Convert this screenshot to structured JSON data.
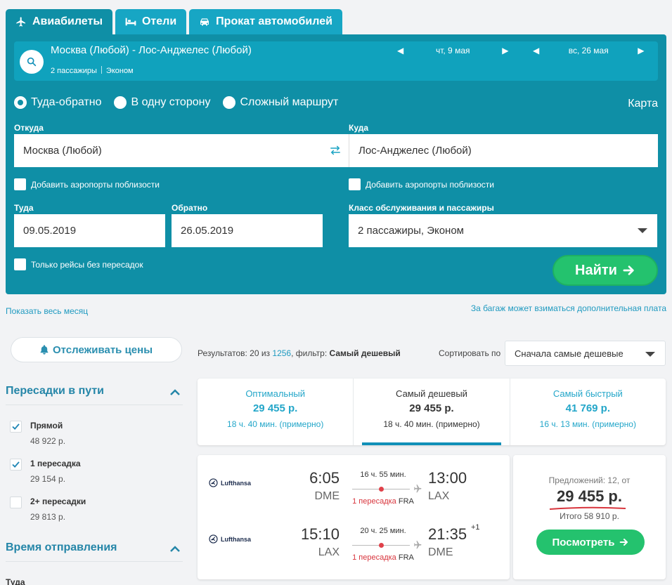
{
  "tabs": [
    {
      "label": "Авиабилеты",
      "icon": "airplane-icon"
    },
    {
      "label": "Отели",
      "icon": "bed-icon"
    },
    {
      "label": "Прокат автомобилей",
      "icon": "car-icon"
    }
  ],
  "summary": {
    "route": "Москва (Любой) - Лос-Анджелес (Любой)",
    "passengers": "2 пассажиры",
    "class": "Эконом",
    "date1": "чт, 9 мая",
    "date2": "вс, 26 мая"
  },
  "trip_types": [
    "Туда-обратно",
    "В одну сторону",
    "Сложный маршрут"
  ],
  "map_label": "Карта",
  "from": {
    "label": "Откуда",
    "value": "Москва (Любой)"
  },
  "to": {
    "label": "Куда",
    "value": "Лос-Анджелес (Любой)"
  },
  "nearby_label": "Добавить аэропорты поблизости",
  "depart": {
    "label": "Туда",
    "value": "09.05.2019"
  },
  "return": {
    "label": "Обратно",
    "value": "26.05.2019"
  },
  "cabin": {
    "label": "Класс обслуживания и пассажиры",
    "value": "2 пассажиры, Эконом"
  },
  "direct_only_label": "Только рейсы без пересадок",
  "find_label": "Найти",
  "show_month": "Показать весь месяц",
  "baggage_note": "За багаж может взиматься дополнительная плата",
  "track_label": "Отслеживать цены",
  "results": {
    "prefix": "Результатов: 20 из",
    "total": "1256",
    "filter_prefix": ", фильтр:",
    "filter_value": "Самый дешевый"
  },
  "sort": {
    "label": "Сортировать по",
    "value": "Сначала самые дешевые"
  },
  "stops_section": {
    "title": "Пересадки в пути",
    "options": [
      {
        "name": "Прямой",
        "price": "48 922 р.",
        "checked": true
      },
      {
        "name": "1 пересадка",
        "price": "29 154 р.",
        "checked": true
      },
      {
        "name": "2+ пересадки",
        "price": "29 813 р.",
        "checked": false
      }
    ]
  },
  "departure_section": {
    "title": "Время отправления",
    "first_label": "Туда"
  },
  "sort_tabs": [
    {
      "title": "Оптимальный",
      "price": "29 455 р.",
      "duration": "18 ч. 40 мин. (примерно)",
      "active": false
    },
    {
      "title": "Самый дешевый",
      "price": "29 455 р.",
      "duration": "18 ч. 40 мин. (примерно)",
      "active": true
    },
    {
      "title": "Самый быстрый",
      "price": "41 769 р.",
      "duration": "16 ч. 13 мин. (примерно)",
      "active": false
    }
  ],
  "ticket": {
    "legs": [
      {
        "airline": "Lufthansa",
        "dep_time": "6:05",
        "dep_code": "DME",
        "duration": "16 ч. 55 мин.",
        "stops": "1 пересадка",
        "via": "FRA",
        "arr_time": "13:00",
        "arr_code": "LAX",
        "day_offset": ""
      },
      {
        "airline": "Lufthansa",
        "dep_time": "15:10",
        "dep_code": "LAX",
        "duration": "20 ч. 25 мин.",
        "stops": "1 пересадка",
        "via": "FRA",
        "arr_time": "21:35",
        "arr_code": "DME",
        "day_offset": "+1"
      }
    ],
    "offers": "Предложений: 12, от",
    "price": "29 455 р.",
    "total": "Итого 58 910 р.",
    "view_label": "Посмотреть"
  },
  "colors": {
    "panel": "#0f8fa6",
    "accent": "#24c26e",
    "link": "#1f9ac0",
    "stop_red": "#d8353d"
  }
}
